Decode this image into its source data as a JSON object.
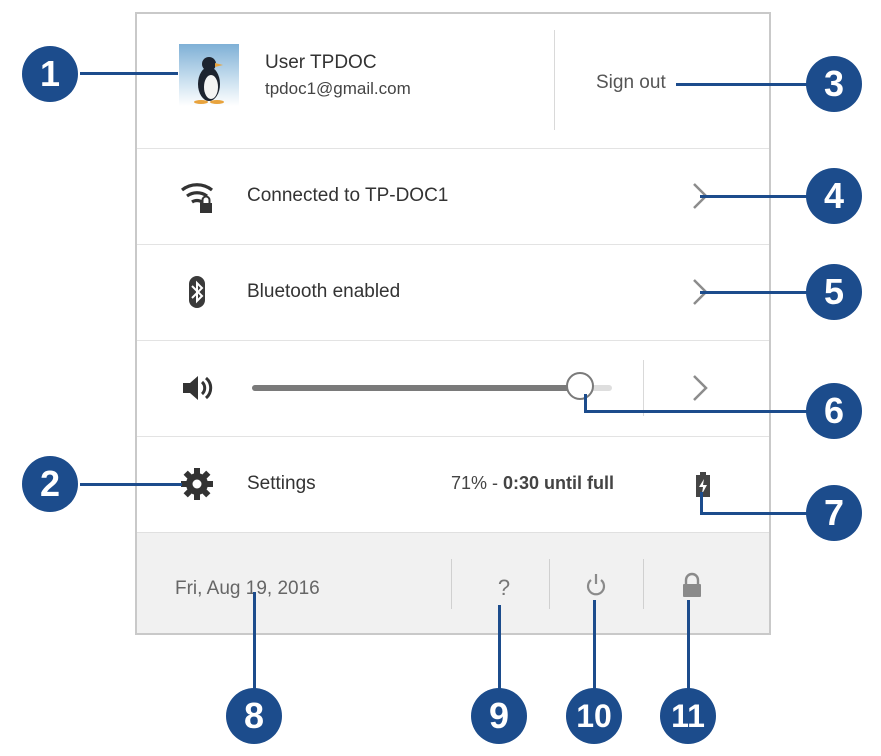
{
  "user": {
    "name": "User TPDOC",
    "email": "tpdoc1@gmail.com",
    "sign_out_label": "Sign out"
  },
  "network": {
    "label": "Connected to TP-DOC1",
    "icon": "wifi-lock-icon"
  },
  "bluetooth": {
    "label": "Bluetooth enabled",
    "icon": "bluetooth-icon"
  },
  "volume": {
    "icon": "speaker-icon",
    "level": 0.91
  },
  "settings": {
    "label": "Settings",
    "icon": "gear-icon"
  },
  "battery": {
    "percent": "71%",
    "separator": " - ",
    "time": "0:30 until full",
    "icon": "battery-charging-icon"
  },
  "footer": {
    "date": "Fri, Aug 19, 2016",
    "help_label": "?",
    "power_icon": "power-icon",
    "lock_icon": "lock-icon"
  },
  "callouts": [
    "1",
    "2",
    "3",
    "4",
    "5",
    "6",
    "7",
    "8",
    "9",
    "10",
    "11"
  ],
  "colors": {
    "callout": "#1c4c8c",
    "footer_bg": "#f1f1f1",
    "slider_fill": "#7a7a7a"
  }
}
